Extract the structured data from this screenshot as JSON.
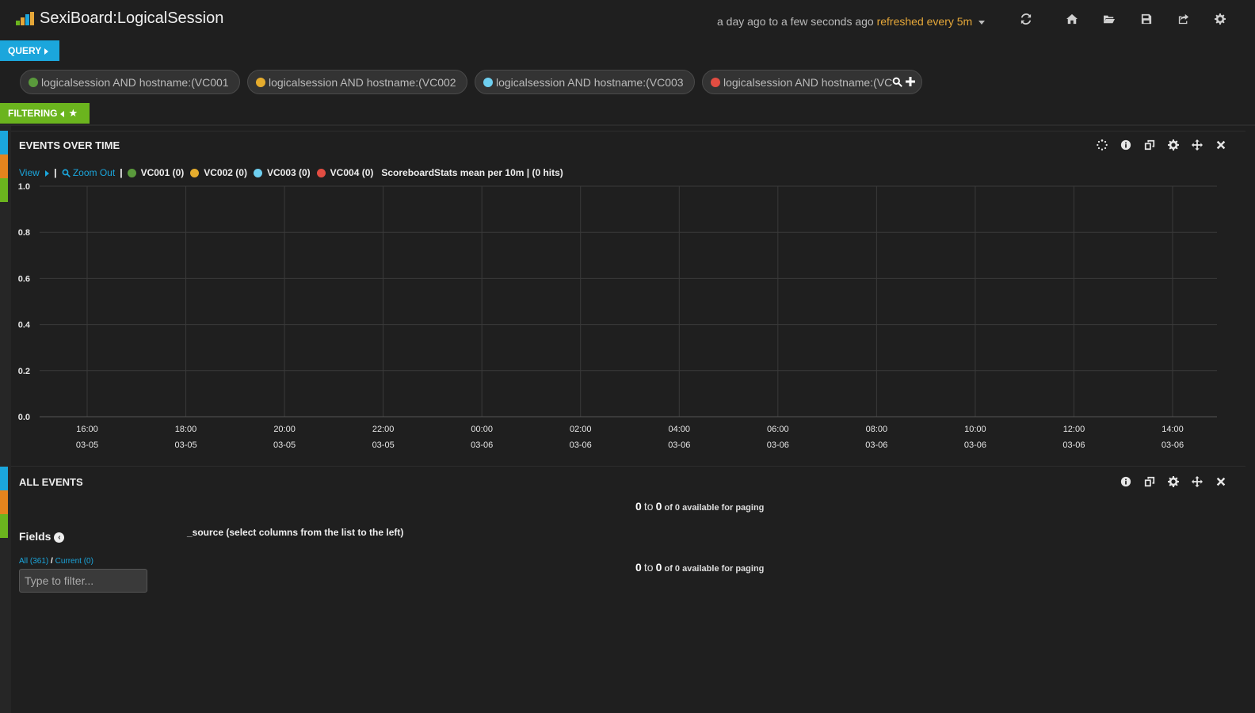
{
  "app": {
    "title": "SexiBoard:LogicalSession",
    "timespan": "a day ago to a few seconds ago",
    "refresh": "refreshed every 5m",
    "nav_icons": [
      "refresh-icon",
      "home-icon",
      "folder-open-icon",
      "save-icon",
      "share-icon",
      "gear-icon"
    ],
    "logo_colors": [
      "#6bb41e",
      "#e5a739",
      "#1ba6dc"
    ]
  },
  "query_tab": {
    "label": "QUERY"
  },
  "filter_tab": {
    "label": "FILTERING"
  },
  "queries": [
    {
      "text": "logicalsession AND hostname:(VC001",
      "color": "#5a9a3c"
    },
    {
      "text": "logicalsession AND hostname:(VC002",
      "color": "#e5ac2d"
    },
    {
      "text": "logicalsession AND hostname:(VC003",
      "color": "#6ecff0"
    },
    {
      "text": "logicalsession AND hostname:(VC",
      "color": "#e24d42"
    }
  ],
  "rail_colors": [
    "#1ba6dc",
    "#e5841d",
    "#6bb41e"
  ],
  "events_panel": {
    "title": "EVENTS OVER TIME",
    "view_label": "View",
    "zoom_label": "Zoom Out",
    "legend": [
      {
        "label": "VC001 (0)",
        "color": "#5a9a3c"
      },
      {
        "label": "VC002 (0)",
        "color": "#e5ac2d"
      },
      {
        "label": "VC003 (0)",
        "color": "#6ecff0"
      },
      {
        "label": "VC004 (0)",
        "color": "#e24d42"
      }
    ],
    "legend_desc": "ScoreboardStats mean per 10m | (0 hits)"
  },
  "chart_data": {
    "type": "line",
    "title": "",
    "xlabel": "",
    "ylabel": "",
    "ylim": [
      0,
      1
    ],
    "yticks": [
      "0.0",
      "0.2",
      "0.4",
      "0.6",
      "0.8",
      "1.0"
    ],
    "x_ticks": [
      {
        "time": "16:00",
        "date": "03-05"
      },
      {
        "time": "18:00",
        "date": "03-05"
      },
      {
        "time": "20:00",
        "date": "03-05"
      },
      {
        "time": "22:00",
        "date": "03-05"
      },
      {
        "time": "00:00",
        "date": "03-06"
      },
      {
        "time": "02:00",
        "date": "03-06"
      },
      {
        "time": "04:00",
        "date": "03-06"
      },
      {
        "time": "06:00",
        "date": "03-06"
      },
      {
        "time": "08:00",
        "date": "03-06"
      },
      {
        "time": "10:00",
        "date": "03-06"
      },
      {
        "time": "12:00",
        "date": "03-06"
      },
      {
        "time": "14:00",
        "date": "03-06"
      }
    ],
    "series": [
      {
        "name": "VC001",
        "values": []
      },
      {
        "name": "VC002",
        "values": []
      },
      {
        "name": "VC003",
        "values": []
      },
      {
        "name": "VC004",
        "values": []
      }
    ],
    "grid": true
  },
  "all_events_panel": {
    "title": "ALL EVENTS",
    "paging_from": "0",
    "paging_to_word": "to",
    "paging_to": "0",
    "paging_suffix": "of 0 available for paging",
    "fields_title": "Fields",
    "fields_all": "All (361)",
    "fields_current": "Current (0)",
    "filter_placeholder": "Type to filter...",
    "source_label": "_source (select columns from the list to the left)"
  }
}
